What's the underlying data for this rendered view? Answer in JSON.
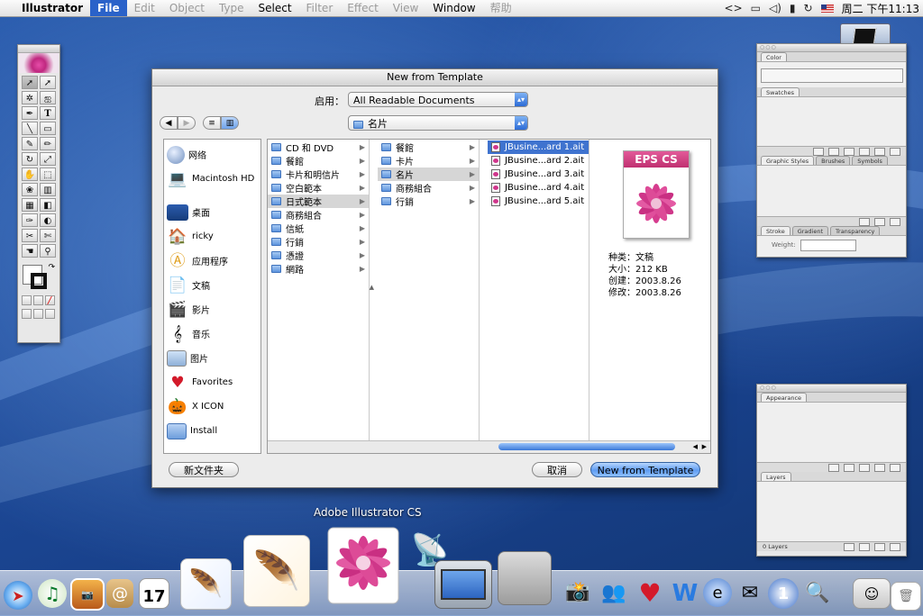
{
  "menubar": {
    "items": [
      "Illustrator",
      "File",
      "Edit",
      "Object",
      "Type",
      "Select",
      "Filter",
      "Effect",
      "View",
      "Window",
      "帮助"
    ],
    "clock": "周二 下午11:13"
  },
  "dialog": {
    "title": "New from Template",
    "enable_label": "启用：",
    "enable_value": "All Readable Documents",
    "location_value": "名片",
    "sidebar": [
      {
        "label": "网络",
        "icon": "network-icon"
      },
      {
        "label": "Macintosh HD",
        "icon": "laptop-icon"
      },
      {
        "label": "桌面",
        "icon": "desktop-icon"
      },
      {
        "label": "ricky",
        "icon": "home-icon"
      },
      {
        "label": "应用程序",
        "icon": "applications-icon"
      },
      {
        "label": "文稿",
        "icon": "documents-icon"
      },
      {
        "label": "影片",
        "icon": "movies-icon"
      },
      {
        "label": "音乐",
        "icon": "music-icon"
      },
      {
        "label": "图片",
        "icon": "pictures-icon"
      },
      {
        "label": "Favorites",
        "icon": "heart-icon"
      },
      {
        "label": "X ICON",
        "icon": "pumpkin-icon"
      },
      {
        "label": "Install",
        "icon": "folder-icon"
      }
    ],
    "col1": [
      "CD 和 DVD",
      "餐館",
      "卡片和明信片",
      "空白範本",
      "日式範本",
      "商務組合",
      "信紙",
      "行銷",
      "憑證",
      "網路"
    ],
    "col2": [
      "餐館",
      "卡片",
      "名片",
      "商務組合",
      "行銷"
    ],
    "col3": [
      "JBusine...ard 1.ait",
      "JBusine...ard 2.ait",
      "JBusine...ard 3.ait",
      "JBusine...ard 4.ait",
      "JBusine...ard 5.ait"
    ],
    "preview": {
      "badge": "EPS CS",
      "info": [
        {
          "k": "种类：",
          "v": "文稿"
        },
        {
          "k": "大小：",
          "v": "212 KB"
        },
        {
          "k": "创建：",
          "v": "2003.8.26"
        },
        {
          "k": "修改：",
          "v": "2003.8.26"
        }
      ]
    },
    "buttons": {
      "new_folder": "新文件夹",
      "cancel": "取消",
      "confirm": "New from Template"
    }
  },
  "palettes": {
    "color_tab": "Color",
    "swatches_tab": "Swatches",
    "styles_tabs": [
      "Graphic Styles",
      "Brushes",
      "Symbols"
    ],
    "stroke_tabs": [
      "Stroke",
      "Gradient",
      "Transparency"
    ],
    "weight_label": "Weight:",
    "appearance_tab": "Appearance",
    "layers_tab": "Layers",
    "layers_count": "0 Layers"
  },
  "dock": {
    "tooltip": "Adobe Illustrator CS",
    "items": [
      "safari-icon",
      "itunes-icon",
      "iphoto-icon",
      "address-book-icon",
      "ical-icon",
      "photoshop-feather-icon",
      "illustrator-feather-icon",
      "illustrator-cs-icon",
      "satellite-dish-icon",
      "virtual-pc-icon",
      "system-preferences-icon",
      "photo-camera-icon",
      "messenger-icon",
      "heart-icon",
      "ie-icon",
      "mail-icon",
      "msn-icon",
      "compass-icon",
      "sherlock-icon",
      "finder-icon",
      "trash-icon"
    ]
  }
}
